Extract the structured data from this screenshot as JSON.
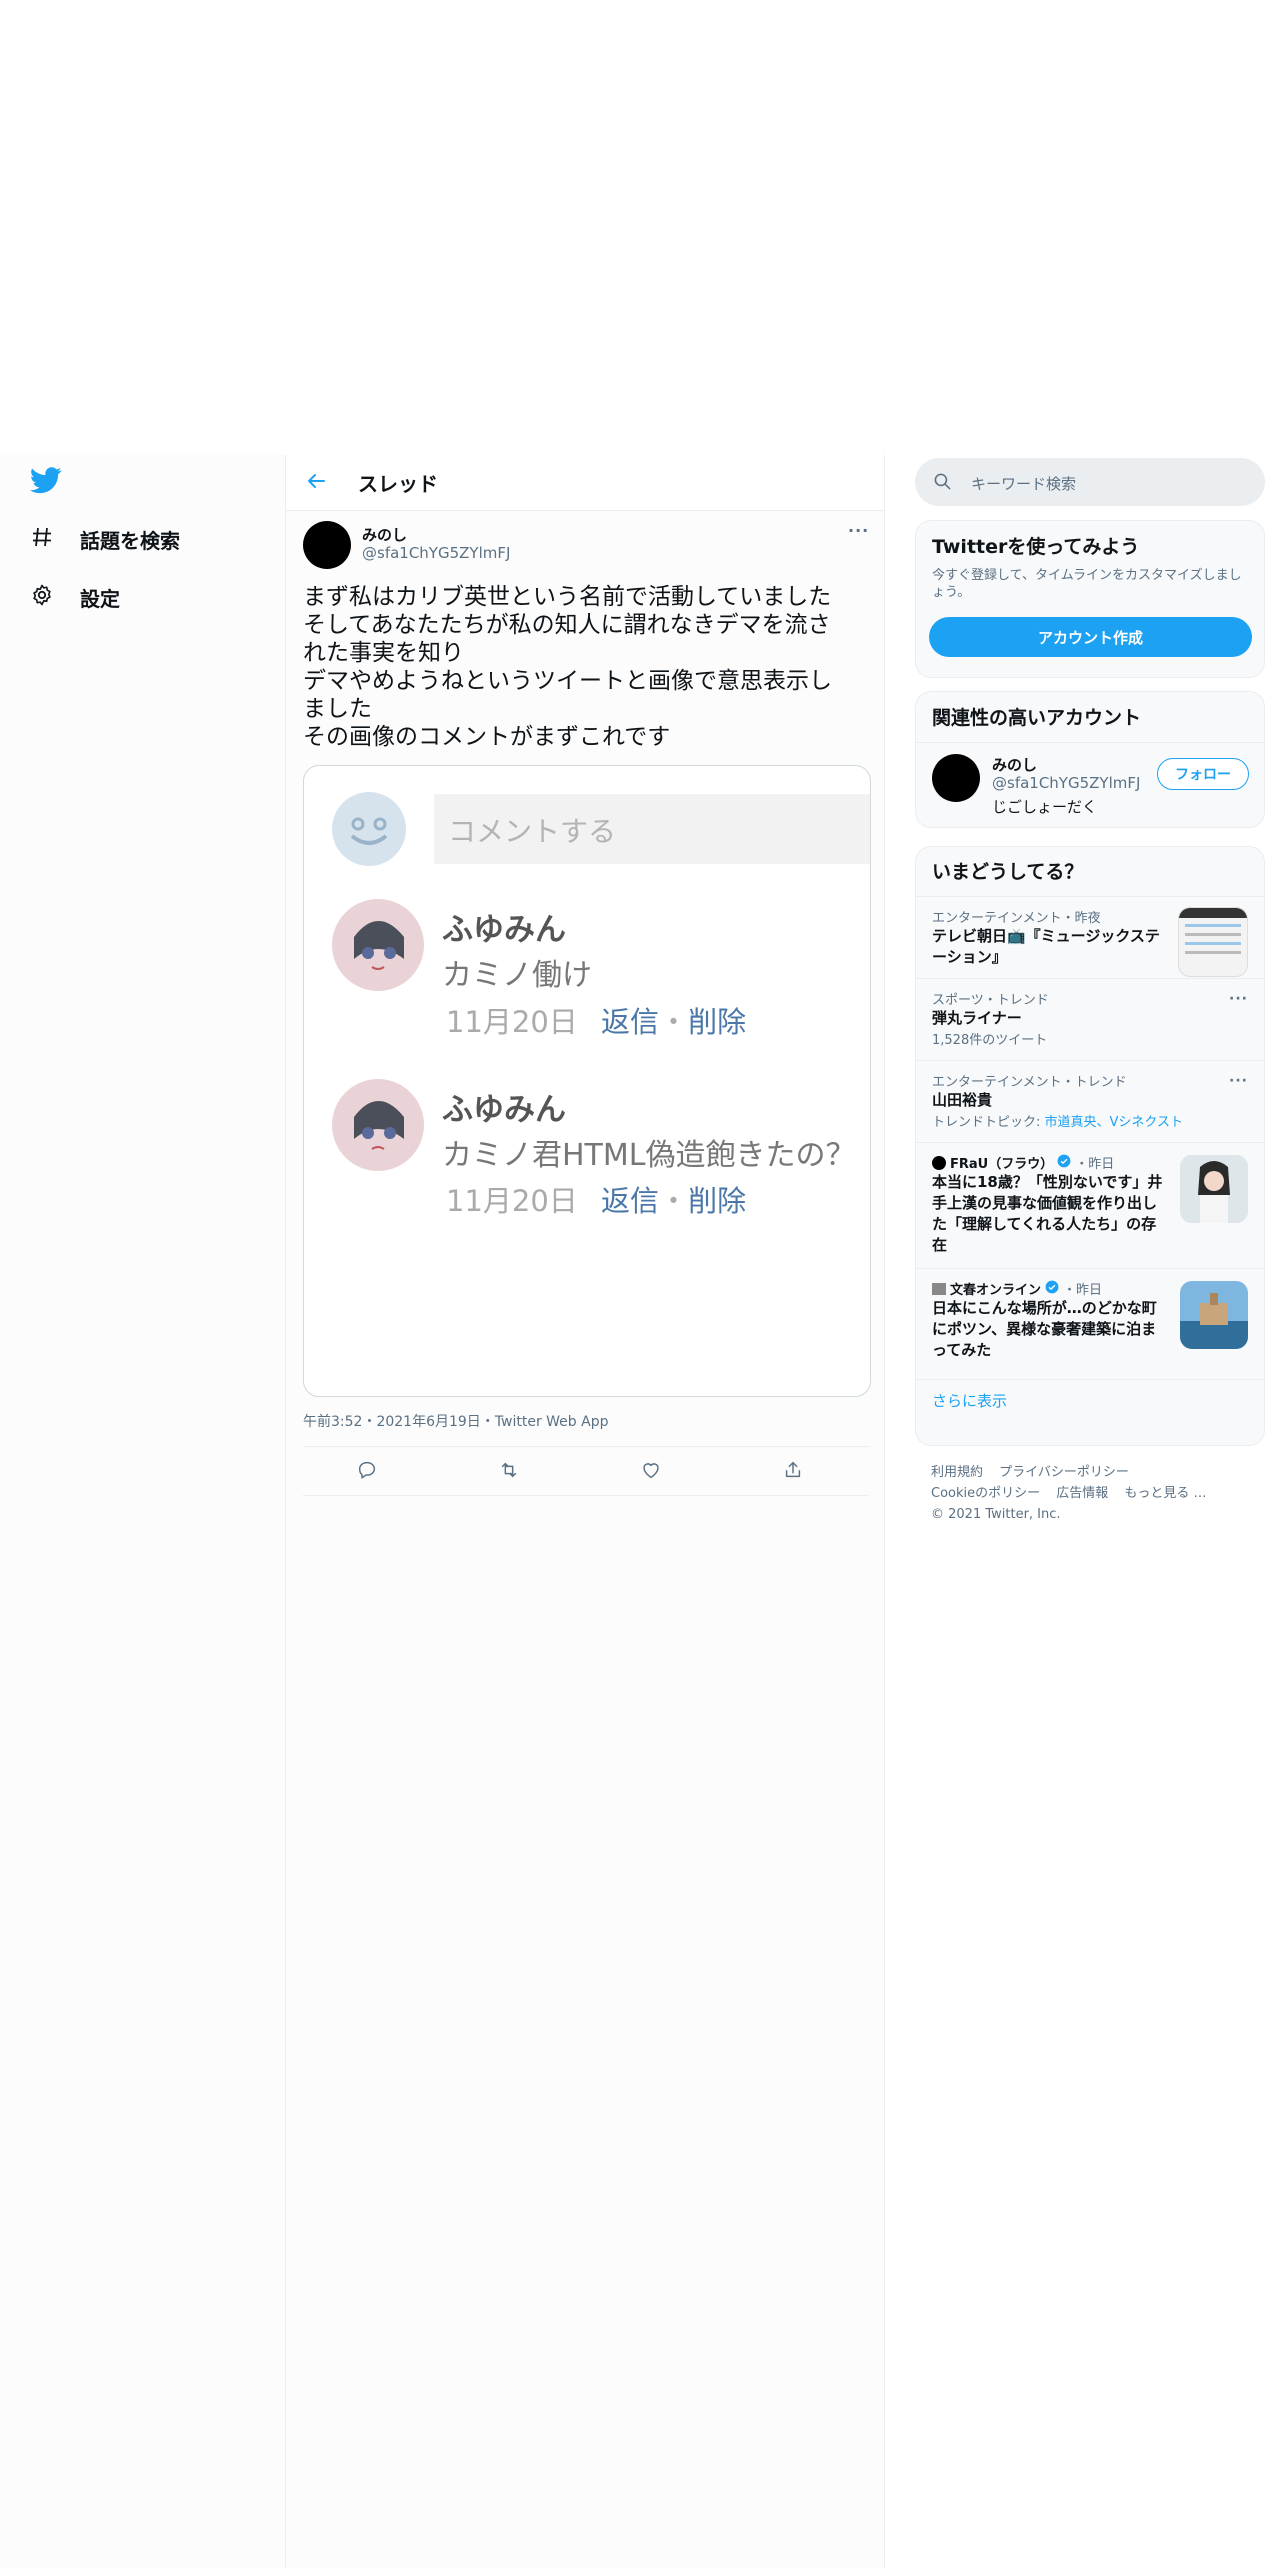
{
  "nav": {
    "items": [
      {
        "label": "話題を検索",
        "icon": "hashtag-icon"
      },
      {
        "label": "設定",
        "icon": "gear-icon"
      }
    ]
  },
  "header": {
    "title": "スレッド"
  },
  "tweet": {
    "display_name": "みのし",
    "handle": "@sfa1ChYG5ZYlmFJ",
    "lines": [
      "まず私はカリブ英世という名前で活動していました",
      "そしてあなたたちが私の知人に謂れなきデマを流さ",
      "れた事実を知り",
      "デマやめようねというツイートと画像で意思表示し",
      "ました",
      "その画像のコメントがまずこれです"
    ],
    "timestamp": "午前3:52・2021年6月19日・Twitter Web App"
  },
  "screenshot": {
    "comment_placeholder": "コメントする",
    "comments": [
      {
        "name": "ふゆみん",
        "text": "カミノ働け",
        "date": "11月20日",
        "reply": "返信",
        "sep": "・",
        "delete": "削除"
      },
      {
        "name": "ふゆみん",
        "text": "カミノ君HTML偽造飽きたの？",
        "date": "11月20日",
        "reply": "返信",
        "sep": "・",
        "delete": "削除"
      }
    ]
  },
  "search": {
    "placeholder": "キーワード検索"
  },
  "signup": {
    "title": "Twitterを使ってみよう",
    "subtitle": "今すぐ登録して、タイムラインをカスタマイズしましょう。",
    "button": "アカウント作成"
  },
  "related": {
    "title": "関連性の高いアカウント",
    "name": "みのし",
    "handle": "@sfa1ChYG5ZYlmFJ",
    "bio": "じごしょーだく",
    "follow": "フォロー"
  },
  "trends": {
    "title": "いまどうしてる？",
    "items": [
      {
        "meta": "エンターテインメント・昨夜",
        "title1": "テレビ朝日📺『ミュージックステ",
        "title2": "ーション』"
      },
      {
        "meta": "スポーツ・トレンド",
        "title1": "弾丸ライナー",
        "sub": "1,528件のツイート"
      },
      {
        "meta": "エンターテインメント・トレンド",
        "title1": "山田裕貴",
        "topic_label": "トレンドトピック: ",
        "topic_links": "市道真央、Vシネクスト"
      },
      {
        "source": "FRaU（フラウ）",
        "time": "・昨日",
        "l1": "本当に18歳？「性別ないです」井",
        "l2": "手上漢の見事な価値観を作り出し",
        "l3": "た「理解してくれる人たち」の存",
        "l4": "在"
      },
      {
        "source": "文春オンライン",
        "time": "・昨日",
        "l1": "日本にこんな場所が…のどかな町",
        "l2": "にポツン、異様な豪奢建築に泊ま",
        "l3": "ってみた"
      }
    ],
    "more": "さらに表示"
  },
  "footer": {
    "line1": [
      "利用規約",
      "プライバシーポリシー"
    ],
    "line2": [
      "Cookieのポリシー",
      "広告情報",
      "もっと見る …"
    ],
    "copyright": "© 2021 Twitter, Inc."
  },
  "colors": {
    "accent": "#1da1f2",
    "muted": "#5b7083",
    "border": "#ebeef0"
  }
}
